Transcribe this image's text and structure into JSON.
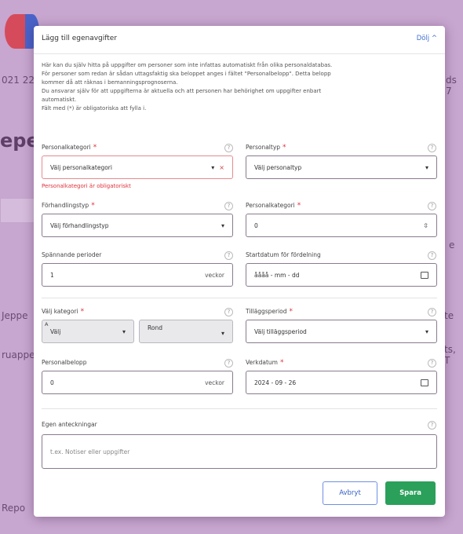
{
  "background": {
    "heading": "eper",
    "left_labels": [
      "021 22",
      "Jeppe",
      "ruappe",
      "Repo"
    ],
    "right_labels": [
      "ds 7",
      "e",
      "te",
      "ts, T"
    ]
  },
  "modal": {
    "title": "Lägg till egenavgifter",
    "hide_label": "Dölj ^",
    "info_lines": [
      "Här kan du själv hitta på uppgifter om personer som inte infattas automatiskt från olika personaldatabas.",
      "För personer som redan är sådan uttagsfaktig ska beloppet anges i fältet \"Personalbelopp\". Detta belopp",
      "kommer då att räknas i bemanningsprognoserna.",
      "Du ansvarar själv för att uppgifterna är aktuella och att personen har behörighet om uppgifter enbart",
      "automatiskt.",
      "Fält med (*) är obligatoriska att fylla i."
    ],
    "fields": {
      "personalkategori": {
        "label": "Personalkategori",
        "placeholder": "Välj personalkategori",
        "error": "Personalkategori är obligatoriskt"
      },
      "personaltyp": {
        "label": "Personaltyp",
        "placeholder": "Välj personaltyp"
      },
      "forhandlingstyp": {
        "label": "Förhandlingstyp",
        "placeholder": "Välj förhandlingstyp"
      },
      "personalkategori2": {
        "label": "Personalkategori",
        "value": "0"
      },
      "spannande_perioder": {
        "label": "Spännande perioder",
        "value": "1",
        "suffix": "veckor"
      },
      "startdatum": {
        "label": "Startdatum för fördelning",
        "value": "åååå - mm - dd"
      },
      "valj_kategori": {
        "label": "Välj kategori",
        "sublabel_a": "A",
        "value_a": "Välj",
        "value_b": "Rond"
      },
      "tillaggsperiod": {
        "label": "Tilläggsperiod",
        "placeholder": "Välj tilläggsperiod"
      },
      "personalbelopp": {
        "label": "Personalbelopp",
        "value": "0",
        "suffix": "veckor"
      },
      "verkdatum": {
        "label": "Verkdatum",
        "value": "2024 - 09 - 26"
      },
      "egen_anteckningar": {
        "label": "Egen anteckningar",
        "placeholder": "t.ex. Notiser eller uppgifter"
      }
    },
    "buttons": {
      "cancel": "Avbryt",
      "save": "Spara"
    }
  }
}
